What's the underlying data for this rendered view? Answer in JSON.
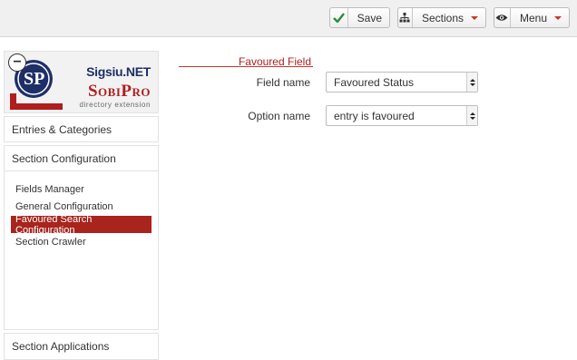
{
  "toolbar": {
    "save_label": "Save",
    "sections_label": "Sections",
    "menu_label": "Menu"
  },
  "logo": {
    "badge_letters": "SP",
    "brand": "Sigsiu.NET",
    "product": "SobiPro",
    "tagline": "directory extension"
  },
  "sidebar": {
    "entries_categories": "Entries & Categories",
    "section_configuration": "Section Configuration",
    "items": [
      {
        "label": "Fields Manager"
      },
      {
        "label": "General Configuration"
      },
      {
        "label": "Favoured Search Configuration"
      },
      {
        "label": "Section Crawler"
      }
    ],
    "section_applications": "Section Applications"
  },
  "form": {
    "legend": "Favoured Field",
    "field_name": {
      "label": "Field name",
      "value": "Favoured Status"
    },
    "option_name": {
      "label": "Option name",
      "value": "entry is favoured"
    }
  },
  "colors": {
    "accent_red": "#a8241d",
    "check_green": "#2e8b3a",
    "logo_blue": "#1e2f68"
  }
}
